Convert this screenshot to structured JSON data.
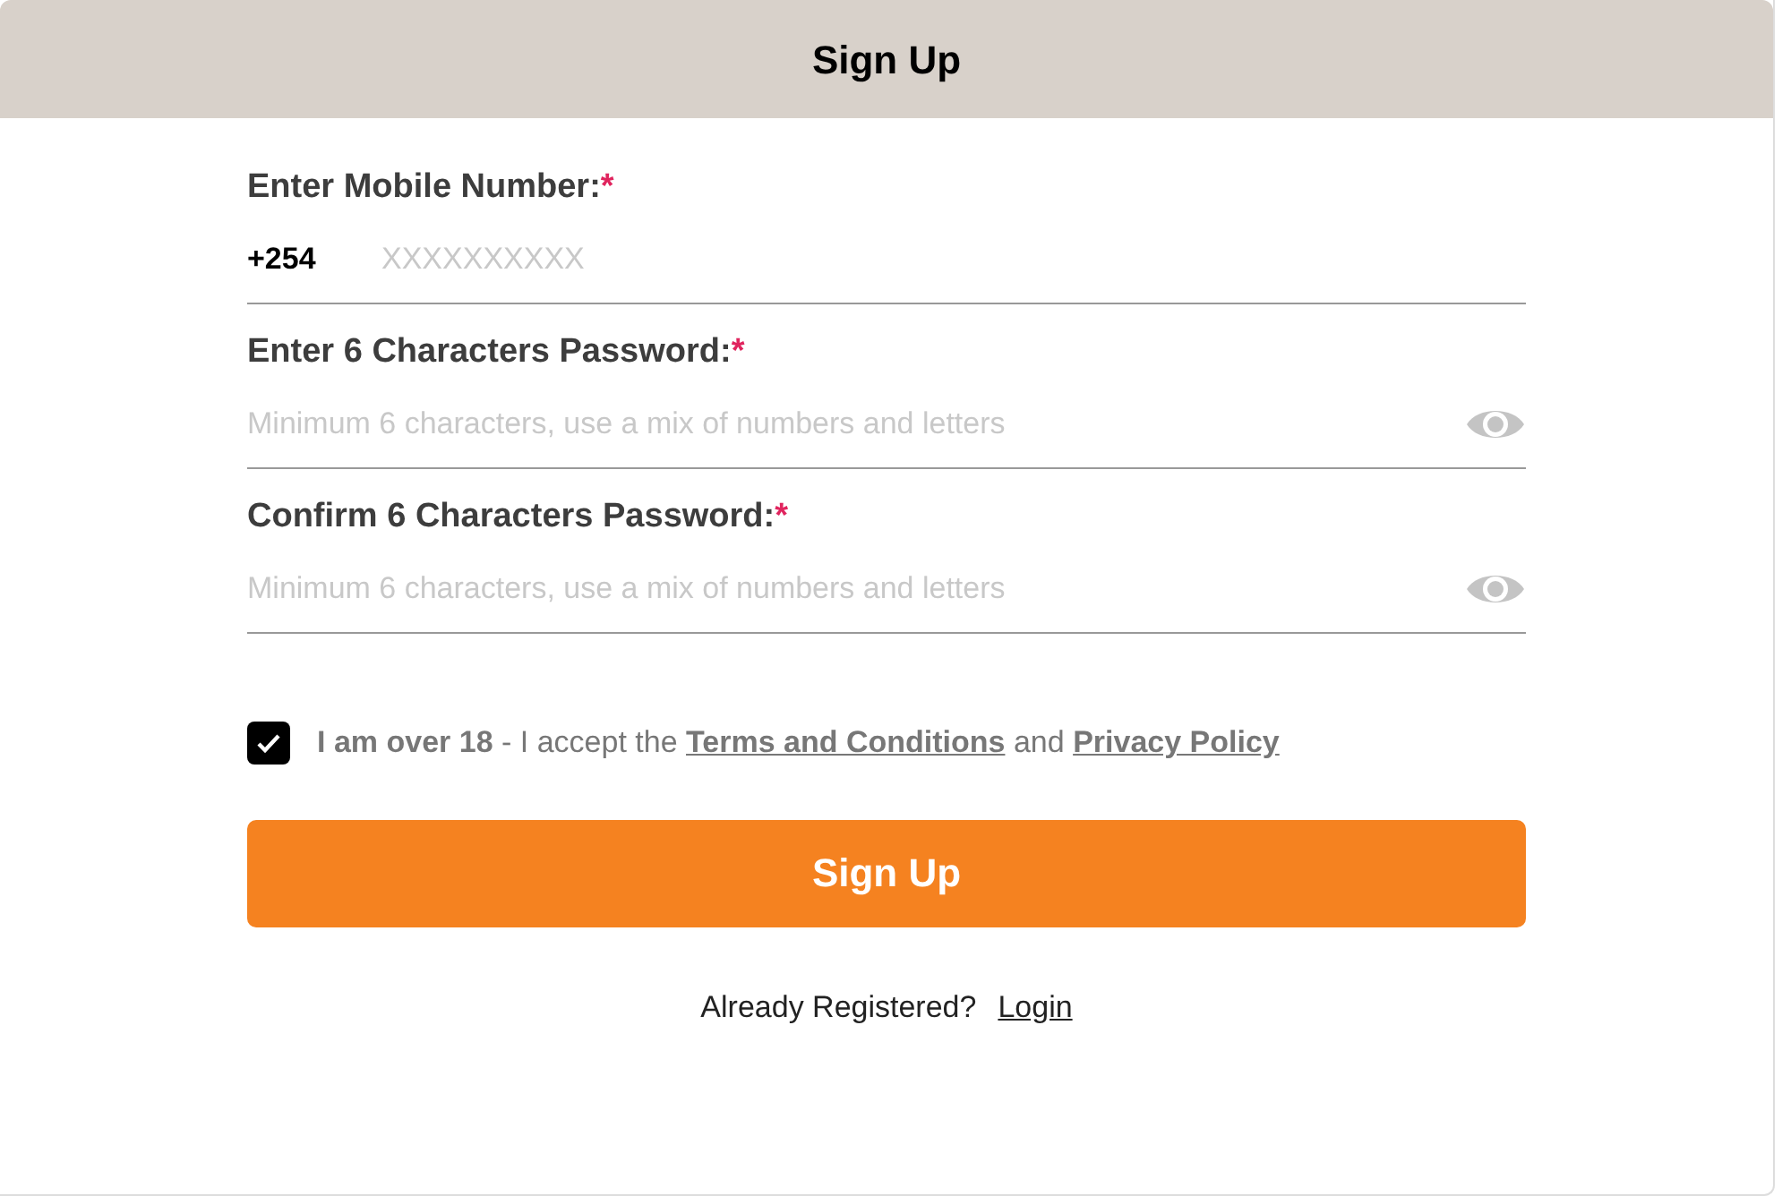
{
  "header": {
    "title": "Sign Up"
  },
  "fields": [
    {
      "kind": "phone",
      "label": "Enter Mobile Number:",
      "required_mark": "*",
      "prefix": "+254",
      "placeholder": "XXXXXXXXXX"
    },
    {
      "kind": "password",
      "label": "Enter 6 Characters Password:",
      "required_mark": "*",
      "placeholder": "Minimum 6 characters, use a mix of numbers and letters"
    },
    {
      "kind": "password",
      "label": "Confirm 6 Characters Password:",
      "required_mark": "*",
      "placeholder": "Minimum 6 characters, use a mix of numbers and letters"
    }
  ],
  "agreement": {
    "checked": true,
    "text_before": "**I am over 18** - I accept the",
    "terms_link": "Terms and Conditions",
    "middle": "and",
    "privacy_link": "Privacy Policy"
  },
  "submit_button": "Sign Up",
  "footer": {
    "text": "Already Registered?",
    "login_link": "Login"
  }
}
